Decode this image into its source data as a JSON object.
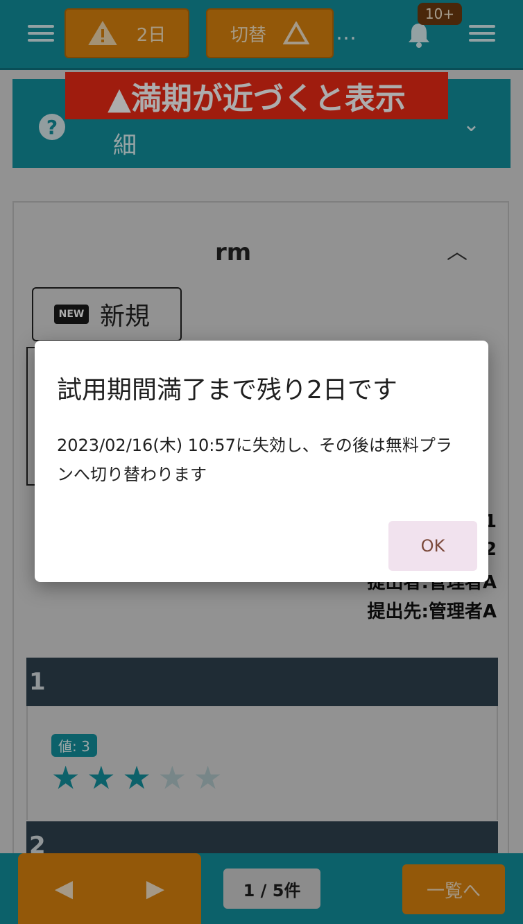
{
  "topbar": {
    "warning_label": "2日",
    "switch_label": "切替",
    "ellipsis": "…",
    "notification_badge": "10+"
  },
  "banner": {
    "text": "▲満期が近づくと表示"
  },
  "help": {
    "text": "細"
  },
  "card": {
    "title": "rm",
    "new_button_label": "新規",
    "new_icon_text": "NEW",
    "right_text": [
      "1",
      "2",
      "提出者:管理者A",
      "提出先:管理者A"
    ]
  },
  "sections": [
    {
      "title": "1",
      "value_badge": "値: 3",
      "rating": 3,
      "max": 5
    },
    {
      "title": "2"
    }
  ],
  "bottombar": {
    "page_indicator": "1 / 5件",
    "list_button": "一覧へ"
  },
  "dialog": {
    "title": "試用期間満了まで残り2日です",
    "body": "2023/02/16(木) 10:57に失効し、その後は無料プランへ切り替わります",
    "ok_label": "OK"
  },
  "colors": {
    "teal": "#138f9c",
    "orange": "#d9820e",
    "red": "#ea2a15",
    "section_dark": "#2f414f"
  }
}
